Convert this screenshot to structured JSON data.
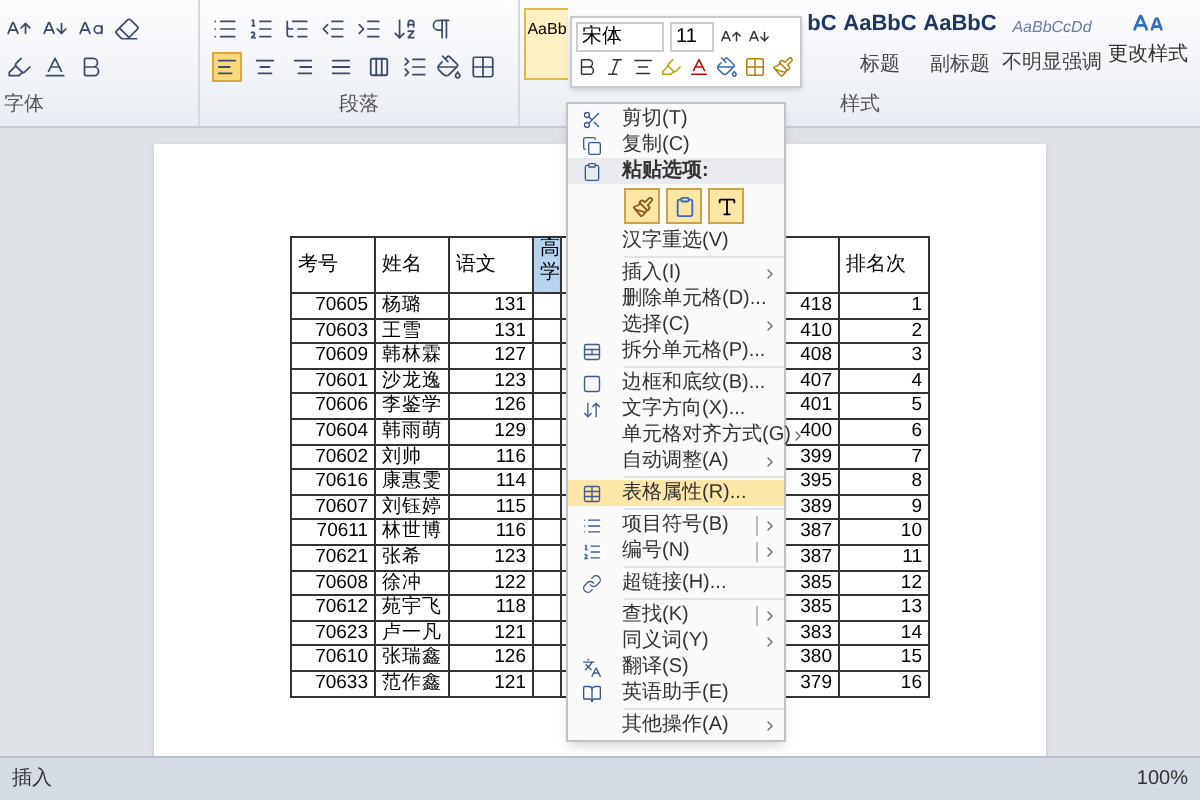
{
  "ribbon": {
    "groups": [
      {
        "label": "字体"
      },
      {
        "label": "段落"
      },
      {
        "label": "样式"
      }
    ],
    "align_buttons": [
      {
        "selected": true
      },
      {
        "selected": false
      },
      {
        "selected": false
      },
      {
        "selected": false
      },
      {
        "selected": false
      }
    ],
    "styles": [
      {
        "preview": "AaBb"
      },
      {
        "preview": "bC"
      },
      {
        "preview": "AaBbC",
        "name": "标题"
      },
      {
        "preview": "AaBbC",
        "name": "副标题"
      },
      {
        "preview": "AaBbCcDd",
        "name": "不明显强调"
      }
    ],
    "change_styles": "更改样式"
  },
  "mini_toolbar": {
    "font": "宋体",
    "size": "11"
  },
  "table": {
    "columns": [
      "考号",
      "姓名",
      "语文",
      "高学",
      "排名次"
    ],
    "rows": [
      {
        "id": "70605",
        "name": "杨璐",
        "score": "131",
        "total": "418",
        "rank": "1"
      },
      {
        "id": "70603",
        "name": "王雪",
        "score": "131",
        "total": "410",
        "rank": "2"
      },
      {
        "id": "70609",
        "name": "韩林霖",
        "score": "127",
        "total": "408",
        "rank": "3"
      },
      {
        "id": "70601",
        "name": "沙龙逸",
        "score": "123",
        "total": "407",
        "rank": "4"
      },
      {
        "id": "70606",
        "name": "李鉴学",
        "score": "126",
        "total": "401",
        "rank": "5"
      },
      {
        "id": "70604",
        "name": "韩雨萌",
        "score": "129",
        "total": "400",
        "rank": "6"
      },
      {
        "id": "70602",
        "name": "刘帅",
        "score": "116",
        "total": "399",
        "rank": "7"
      },
      {
        "id": "70616",
        "name": "康惠雯",
        "score": "114",
        "total": "395",
        "rank": "8"
      },
      {
        "id": "70607",
        "name": "刘钰婷",
        "score": "115",
        "total": "389",
        "rank": "9"
      },
      {
        "id": "70611",
        "name": "林世博",
        "score": "116",
        "total": "387",
        "rank": "10"
      },
      {
        "id": "70621",
        "name": "张希",
        "score": "123",
        "total": "387",
        "rank": "11"
      },
      {
        "id": "70608",
        "name": "徐冲",
        "score": "122",
        "total": "385",
        "rank": "12"
      },
      {
        "id": "70612",
        "name": "苑宇飞",
        "score": "118",
        "total": "385",
        "rank": "13"
      },
      {
        "id": "70623",
        "name": "卢一凡",
        "score": "121",
        "total": "383",
        "rank": "14"
      },
      {
        "id": "70610",
        "name": "张瑞鑫",
        "score": "126",
        "total": "380",
        "rank": "15"
      },
      {
        "id": "70633",
        "name": "范作鑫",
        "score": "121",
        "total": "379",
        "rank": "16"
      }
    ]
  },
  "context_menu": {
    "items": [
      {
        "kind": "item",
        "label": "剪切(T)"
      },
      {
        "kind": "item",
        "label": "复制(C)"
      },
      {
        "kind": "header",
        "label": "粘贴选项:"
      },
      {
        "kind": "paste"
      },
      {
        "kind": "item",
        "label": "汉字重选(V)"
      },
      {
        "kind": "sep"
      },
      {
        "kind": "sub",
        "label": "插入(I)"
      },
      {
        "kind": "item",
        "label": "删除单元格(D)..."
      },
      {
        "kind": "sub",
        "label": "选择(C)"
      },
      {
        "kind": "item",
        "label": "拆分单元格(P)..."
      },
      {
        "kind": "sep"
      },
      {
        "kind": "item",
        "label": "边框和底纹(B)..."
      },
      {
        "kind": "item",
        "label": "文字方向(X)..."
      },
      {
        "kind": "sub",
        "label": "单元格对齐方式(G)"
      },
      {
        "kind": "sub",
        "label": "自动调整(A)"
      },
      {
        "kind": "sep"
      },
      {
        "kind": "item",
        "label": "表格属性(R)...",
        "selected": true
      },
      {
        "kind": "sep"
      },
      {
        "kind": "split",
        "label": "项目符号(B)"
      },
      {
        "kind": "split",
        "label": "编号(N)"
      },
      {
        "kind": "sep"
      },
      {
        "kind": "item",
        "label": "超链接(H)..."
      },
      {
        "kind": "sep"
      },
      {
        "kind": "split",
        "label": "查找(K)"
      },
      {
        "kind": "sub",
        "label": "同义词(Y)"
      },
      {
        "kind": "item",
        "label": "翻译(S)"
      },
      {
        "kind": "item",
        "label": "英语助手(E)"
      },
      {
        "kind": "sep"
      },
      {
        "kind": "sub",
        "label": "其他操作(A)"
      }
    ]
  },
  "status_bar": {
    "mode": "插入",
    "zoom": "100%"
  }
}
